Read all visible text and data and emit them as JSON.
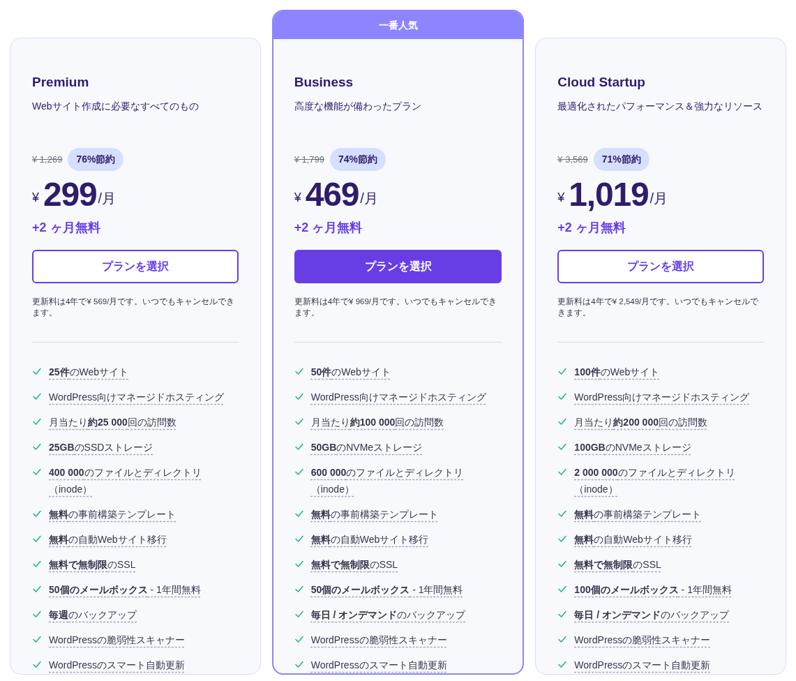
{
  "plans": [
    {
      "highlighted": false,
      "name": "Premium",
      "description": "Webサイト作成に必要なすべてのもの",
      "old_price": "¥ 1,269",
      "discount": "76%節約",
      "currency": "¥",
      "price": "299",
      "period": "/月",
      "bonus": "+2 ヶ月無料",
      "button": {
        "label": "プランを選択",
        "primary": false
      },
      "renewal": "更新料は4年で¥ 569/月です。いつでもキャンセルできます。",
      "features": [
        "**25件**のWebサイト",
        "WordPress向けマネージドホスティング",
        "月当たり**約25 000**回の訪問数",
        "**25GB**のSSDストレージ",
        "**400 000**のファイルとディレクトリ（inode）",
        "**無料**の事前構築テンプレート",
        "**無料**の自動Webサイト移行",
        "**無料で無制限**のSSL",
        "**50個のメールボックス** - 1年間無料",
        "**毎週**のバックアップ",
        "WordPressの脆弱性スキャナー",
        "WordPressのスマート自動更新"
      ]
    },
    {
      "highlighted": true,
      "badge": "一番人気",
      "name": "Business",
      "description": "高度な機能が備わったプラン",
      "old_price": "¥ 1,799",
      "discount": "74%節約",
      "currency": "¥",
      "price": "469",
      "period": "/月",
      "bonus": "+2 ヶ月無料",
      "button": {
        "label": "プランを選択",
        "primary": true
      },
      "renewal": "更新料は4年で¥ 969/月です。いつでもキャンセルできます。",
      "features": [
        "**50件**のWebサイト",
        "WordPress向けマネージドホスティング",
        "月当たり**約100 000**回の訪問数",
        "**50GB**のNVMeストレージ",
        "**600 000**のファイルとディレクトリ（inode）",
        "**無料**の事前構築テンプレート",
        "**無料**の自動Webサイト移行",
        "**無料で無制限**のSSL",
        "**50個のメールボックス** - 1年間無料",
        "**毎日 / オンデマンド**のバックアップ",
        "WordPressの脆弱性スキャナー",
        "WordPressのスマート自動更新"
      ]
    },
    {
      "highlighted": false,
      "name": "Cloud Startup",
      "description": "最適化されたパフォーマンス＆強力なリソース",
      "old_price": "¥ 3,569",
      "discount": "71%節約",
      "currency": "¥",
      "price": "1,019",
      "period": "/月",
      "bonus": "+2 ヶ月無料",
      "button": {
        "label": "プランを選択",
        "primary": false
      },
      "renewal": "更新料は4年で¥ 2,549/月です。いつでもキャンセルできます。",
      "features": [
        "**100件**のWebサイト",
        "WordPress向けマネージドホスティング",
        "月当たり**約200 000**回の訪問数",
        "**100GB**のNVMeストレージ",
        "**2 000 000**のファイルとディレクトリ（inode）",
        "**無料**の事前構築テンプレート",
        "**無料**の自動Webサイト移行",
        "**無料で無制限**のSSL",
        "**100個のメールボックス** - 1年間無料",
        "**毎日 / オンデマンド**のバックアップ",
        "WordPressの脆弱性スキャナー",
        "WordPressのスマート自動更新"
      ]
    }
  ]
}
